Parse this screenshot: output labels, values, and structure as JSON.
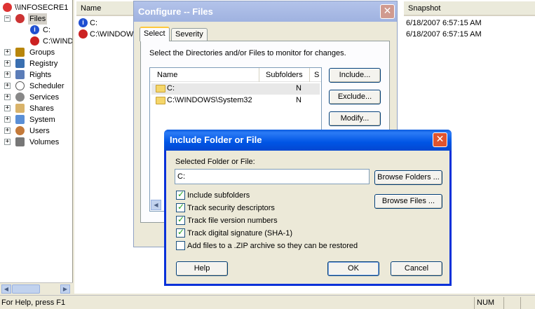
{
  "tree": {
    "root": "\\\\INFOSECRE1",
    "files": "Files",
    "children": [
      "C:",
      "C:\\WIND"
    ],
    "items": [
      "Groups",
      "Registry",
      "Rights",
      "Scheduler",
      "Services",
      "Shares",
      "System",
      "Users",
      "Volumes"
    ]
  },
  "list": {
    "col_name": "Name",
    "col_snapshot": "Snapshot",
    "rows": [
      {
        "name": "C:",
        "snapshot": "6/18/2007 6:57:15 AM"
      },
      {
        "name": "C:\\WINDOW",
        "snapshot": "6/18/2007 6:57:15 AM"
      }
    ]
  },
  "configure": {
    "title": "Configure -- Files",
    "tabs": [
      "Select",
      "Severity"
    ],
    "instruction": "Select the Directories and/or Files to monitor for changes.",
    "col_name": "Name",
    "col_subfolders": "Subfolders",
    "col_s": "S",
    "rows": [
      {
        "name": "C:",
        "subfolders": "N"
      },
      {
        "name": "C:\\WINDOWS\\System32",
        "subfolders": "N"
      }
    ],
    "include_label": "Include...",
    "exclude_label": "Exclude...",
    "modify_label": "Modify..."
  },
  "include": {
    "title": "Include Folder or File",
    "field_label": "Selected Folder or File:",
    "field_value": "C:",
    "browse_folders": "Browse Folders ...",
    "browse_files": "Browse Files ...",
    "options": [
      {
        "label": "Include subfolders",
        "checked": true
      },
      {
        "label": "Track security descriptors",
        "checked": true
      },
      {
        "label": "Track file version numbers",
        "checked": true
      },
      {
        "label": "Track digital signature (SHA-1)",
        "checked": true
      },
      {
        "label": "Add files to a .ZIP archive so they can be restored",
        "checked": false
      }
    ],
    "help_label": "Help",
    "ok_label": "OK",
    "cancel_label": "Cancel"
  },
  "status": {
    "help_text": "For Help, press F1",
    "num": "NUM"
  },
  "colors": {
    "xp_title_blue": "#0055e5",
    "inactive_title": "#9fb2e0",
    "close_red": "#e0542f"
  }
}
